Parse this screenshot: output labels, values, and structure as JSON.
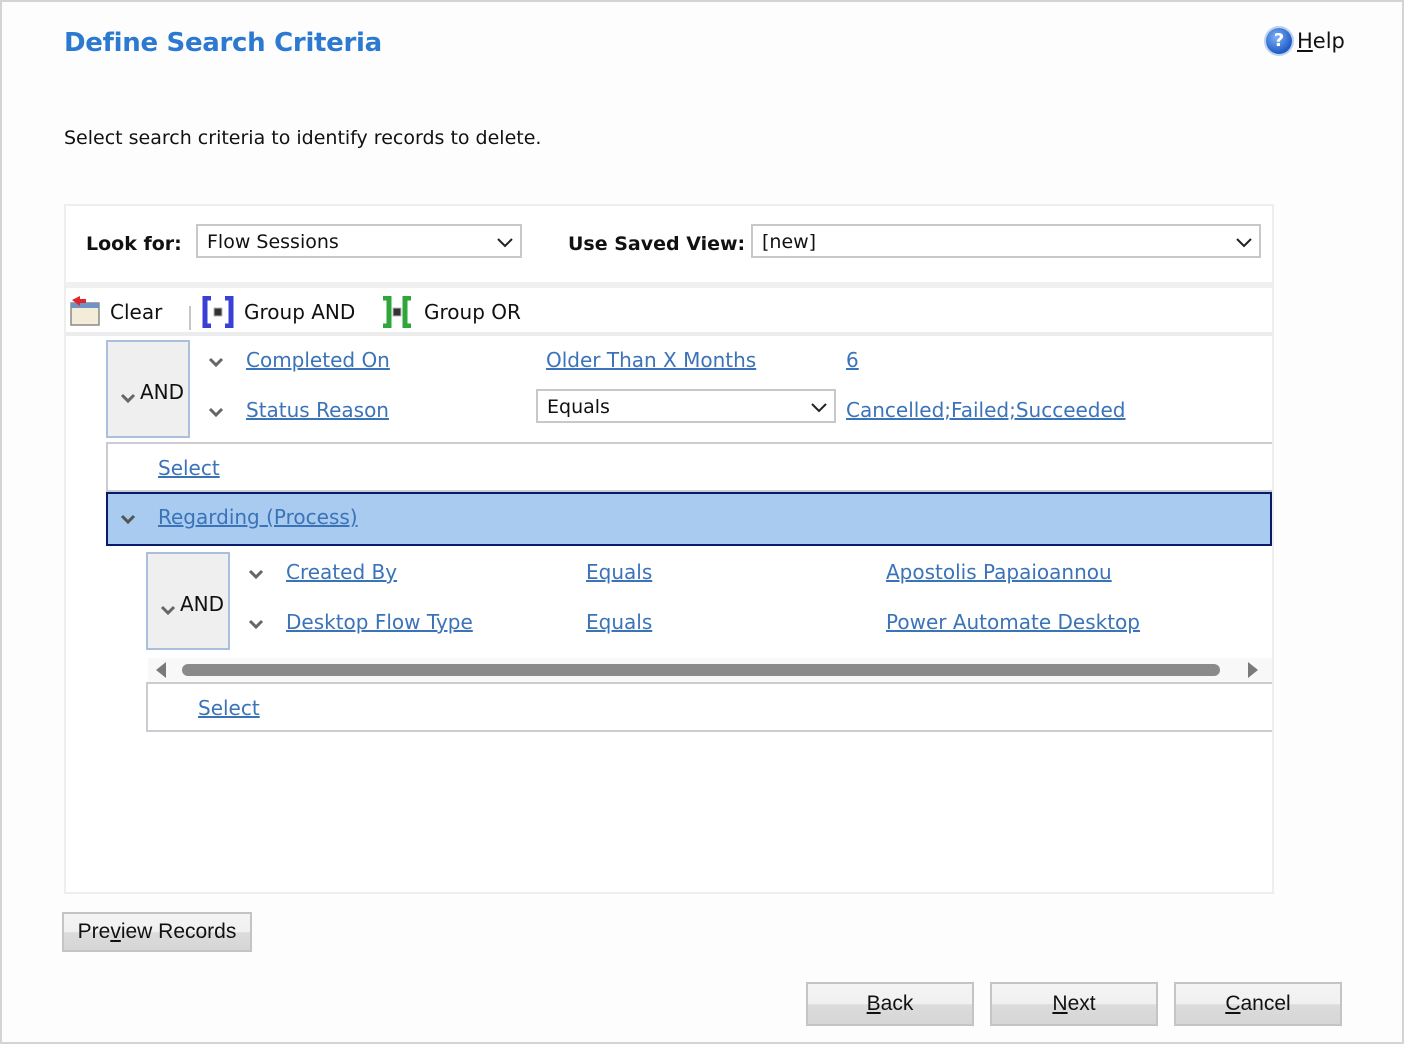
{
  "header": {
    "title": "Define Search Criteria",
    "help": {
      "accesskey": "H",
      "rest": "elp",
      "icon": "help-question-icon"
    },
    "instructions": "Select search criteria to identify records to delete."
  },
  "lookfor": {
    "label": "Look for:",
    "value": "Flow Sessions",
    "saved_view_label": "Use Saved View:",
    "saved_view_value": "[new]"
  },
  "toolbar": {
    "clear": "Clear",
    "group_and": "Group AND",
    "group_or": "Group OR"
  },
  "colors": {
    "title": "#2b79d0",
    "link": "#3b73b9",
    "selected_row": "#a8cbef",
    "selected_border": "#0a1a6b"
  },
  "criteria": {
    "group1": {
      "operator": "AND",
      "rows": [
        {
          "field": "Completed On",
          "condition": "Older Than X Months",
          "value": "6"
        },
        {
          "field": "Status Reason",
          "condition": "Equals",
          "value": "Cancelled;Failed;Succeeded"
        }
      ],
      "select": "Select"
    },
    "related": {
      "entity": "Regarding (Process)",
      "operator": "AND",
      "rows": [
        {
          "field": "Created By",
          "condition": "Equals",
          "value": "Apostolis Papaioannou"
        },
        {
          "field": "Desktop Flow Type",
          "condition": "Equals",
          "value": "Power Automate Desktop"
        }
      ],
      "select": "Select"
    }
  },
  "footer": {
    "preview": {
      "pre": "Pre",
      "key": "v",
      "post": "iew Records"
    },
    "back": {
      "key": "B",
      "rest": "ack"
    },
    "next": {
      "key": "N",
      "rest": "ext"
    },
    "cancel": {
      "key": "C",
      "rest": "ancel"
    }
  }
}
